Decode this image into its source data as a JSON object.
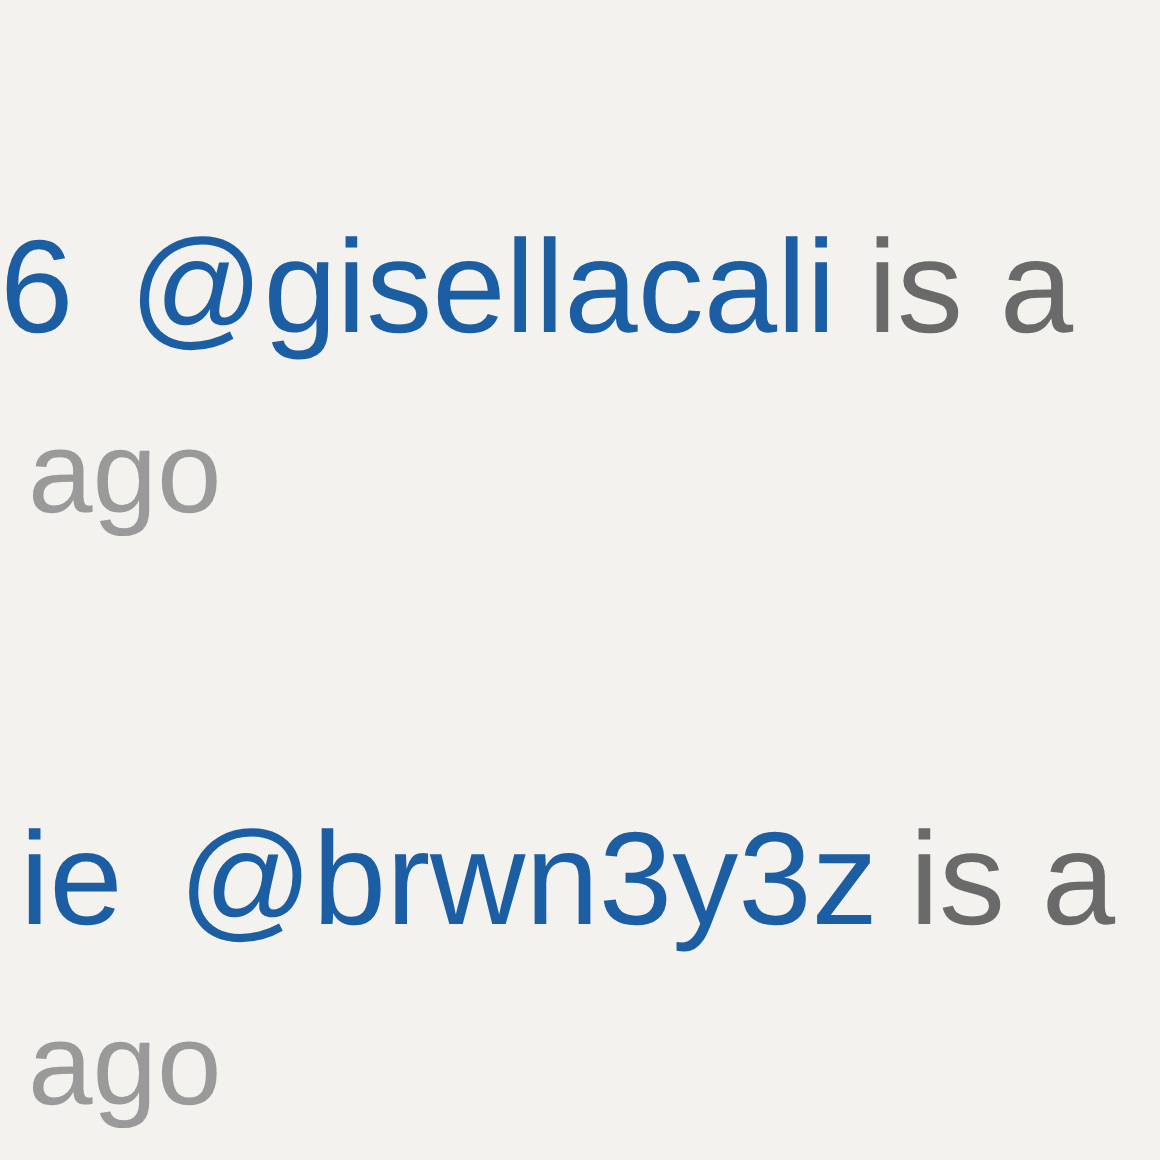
{
  "comments": [
    {
      "author": "6",
      "mention": "@gisellacali",
      "text": "is a",
      "time": "ago"
    },
    {
      "author": "ie",
      "mention": "@brwn3y3z",
      "text": "is a",
      "time": "ago"
    }
  ]
}
